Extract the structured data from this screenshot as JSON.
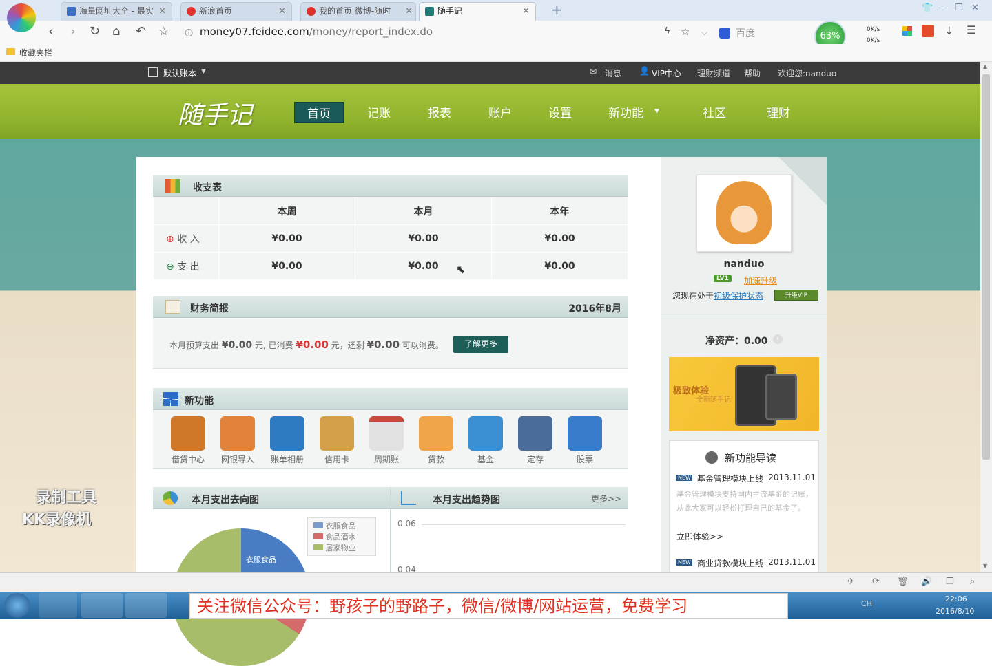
{
  "browser": {
    "tabs": [
      {
        "label": "海量网址大全 - 最实"
      },
      {
        "label": "新浪首页"
      },
      {
        "label": "我的首页 微博-随时"
      },
      {
        "label": "随手记"
      }
    ],
    "url_host": "money07.feidee.com",
    "url_path": "/money/report_index.do",
    "search_engine": "百度",
    "bookmarks_label": "收藏夹栏",
    "speed_percent": "63%",
    "net_up": "0K/s",
    "net_down": "0K/s"
  },
  "site": {
    "account_book": "默认账本",
    "topbar": {
      "msg": "消息",
      "vip": "VIP中心",
      "finance": "理财频道",
      "help": "帮助",
      "welcome": "欢迎您:nanduo"
    },
    "logo": "随手记",
    "menu": [
      "首页",
      "记账",
      "报表",
      "账户",
      "设置",
      "新功能",
      "社区",
      "理财"
    ]
  },
  "income_panel": {
    "title": "收支表",
    "headers": [
      "本周",
      "本月",
      "本年"
    ],
    "rows": [
      {
        "label": "收 入",
        "values": [
          "¥0.00",
          "¥0.00",
          "¥0.00"
        ]
      },
      {
        "label": "支 出",
        "values": [
          "¥0.00",
          "¥0.00",
          "¥0.00"
        ]
      }
    ]
  },
  "report_panel": {
    "title": "财务简报",
    "date": "2016年8月",
    "t1": "本月预算支出",
    "v1": "¥0.00",
    "t2": "元, 已消费",
    "v2": "¥0.00",
    "t3": "元，还剩",
    "v3": "¥0.00",
    "t4": "可以消费。",
    "more_btn": "了解更多"
  },
  "features_panel": {
    "title": "新功能",
    "items": [
      "借贷中心",
      "网银导入",
      "账单相册",
      "信用卡",
      "周期账",
      "贷款",
      "基金",
      "定存",
      "股票"
    ]
  },
  "charts": {
    "pie_title": "本月支出去向图",
    "trend_title": "本月支出趋势图",
    "more": "更多>>",
    "legend": [
      "衣服食品",
      "食品酒水",
      "居家物业"
    ],
    "pie_label": "衣服食品",
    "y_ticks": [
      "0.06",
      "0.04"
    ]
  },
  "user": {
    "name": "nanduo",
    "level": "LV1",
    "speed_up": "加速升级",
    "status_prefix": "您现在处于",
    "status_link": "初级保护状态",
    "upgrade_vip": "升级VIP",
    "net_assets_label": "净资产：",
    "net_assets": "0.00"
  },
  "promo": {
    "line1": "极致体验",
    "line2": "全新随手记"
  },
  "news": {
    "title": "新功能导读",
    "items": [
      {
        "badge": "NEW",
        "title": "基金管理模块上线",
        "date": "2013.11.01",
        "desc": "基金管理模块支持国内主流基金的记账，从此大家可以轻松打理自己的基金了。",
        "link": "立即体验>>"
      },
      {
        "badge": "NEW",
        "title": "商业贷款模块上线",
        "date": "2013.11.01"
      }
    ]
  },
  "watermark": {
    "line1": "录制工具",
    "line2": "KK录像机"
  },
  "taskbar": {
    "banner": "关注微信公众号：野孩子的野路子，微信/微博/网站运营，免费学习",
    "time": "22:06",
    "date": "2016/8/10",
    "ime": "CH"
  }
}
